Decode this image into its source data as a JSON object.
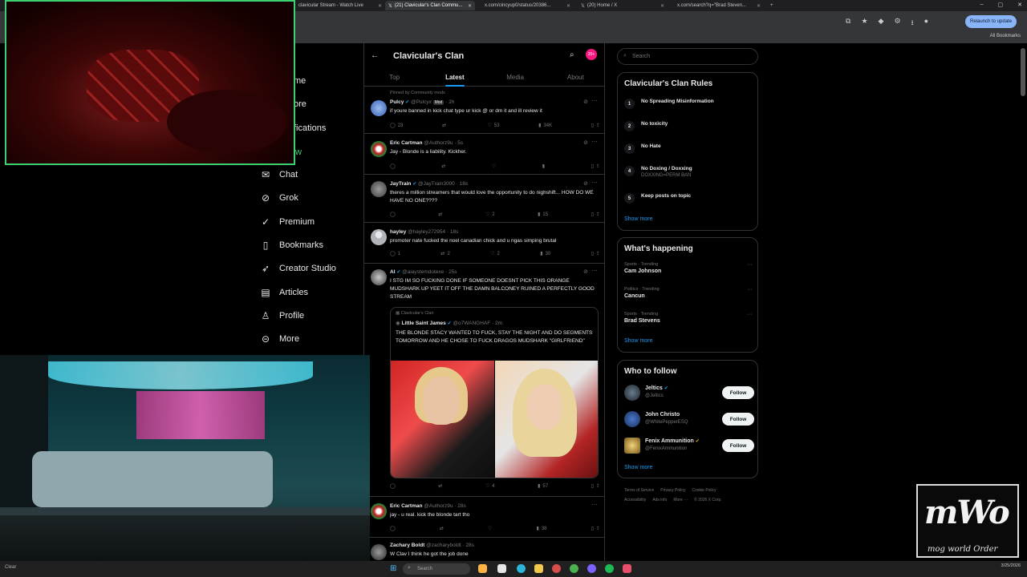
{
  "browser": {
    "tabs": [
      {
        "label": "clavicular Stream - Watch Live"
      },
      {
        "label": "(21) Clavicular's Clan Commu..."
      },
      {
        "label": "x.com/cincyup0/status/20386..."
      },
      {
        "label": "(20) Home / X"
      },
      {
        "label": "x.com/search?q=\"Brad Steven..."
      }
    ],
    "relaunch": "Relaunch to update",
    "all_bookmarks": "All Bookmarks"
  },
  "nav": {
    "partial_items": [
      "me",
      "ore",
      "fications",
      "w"
    ],
    "items": [
      {
        "label": "Chat",
        "icon": "mail-icon"
      },
      {
        "label": "Grok",
        "icon": "grok-icon"
      },
      {
        "label": "Premium",
        "icon": "premium-icon"
      },
      {
        "label": "Bookmarks",
        "icon": "bookmark-icon"
      },
      {
        "label": "Creator Studio",
        "icon": "rocket-icon"
      },
      {
        "label": "Articles",
        "icon": "article-icon"
      },
      {
        "label": "Profile",
        "icon": "person-icon"
      },
      {
        "label": "More",
        "icon": "more-circle-icon"
      }
    ]
  },
  "community": {
    "name": "Clavicular's Clan",
    "badge": "20+",
    "tabs": [
      "Top",
      "Latest",
      "Media",
      "About"
    ],
    "active_tab": "Latest"
  },
  "posts": [
    {
      "pinned": "Pinned by Community mods",
      "name": "Pulcy",
      "handle": "@Pulcyx",
      "badge": "Mod",
      "time": "· 2h",
      "text": "if youre banned in kick chat type ur kick @ or dm it and ill review it",
      "replies": "23",
      "reposts": "",
      "likes": "53",
      "views": "34K"
    },
    {
      "name": "Eric Cartman",
      "handle": "@Authorz9u",
      "time": "· 5s",
      "text": "Jay - Blonde is a liability. Kickher.",
      "replies": "",
      "reposts": "",
      "likes": "",
      "views": ""
    },
    {
      "name": "JayTrain",
      "handle": "@JayTrain3000",
      "time": "· 18s",
      "text": "theres a million streamers that would love the opportunity to do nighshift... HOW DO WE HAVE NO ONE????",
      "replies": "",
      "reposts": "",
      "likes": "2",
      "views": "15"
    },
    {
      "name": "hayley",
      "handle": "@hayley272954",
      "time": "· 18s",
      "text": "promoter nate fucked the noel canadian chick and u ngas simping brutal",
      "replies": "1",
      "reposts": "2",
      "likes": "2",
      "views": "30"
    },
    {
      "name": "Al",
      "handle": "@aiaystemdotexe",
      "time": "· 25s",
      "text": "I STG IM SO FUCKING DONE IF SOMEONE DOESNT PICK THIS ORANGE MUDSHARK UP YEET IT OFF THE DAMN BALCONEY RUINED A PERFECTLY GOOD STREAM",
      "quote": {
        "community": "Clavicular's Clan",
        "name": "Little Saint James",
        "handle": "@o7WANGHAF",
        "time": "· 2m",
        "text": "THE BLONDE STACY WANTED TO FUCK, STAY THE NIGHT AND DO SEGMENTS TOMORROW AND HE CHOSE TO FUCK DRAGOS MUDSHARK \"GIRLFRIEND\""
      },
      "replies": "",
      "reposts": "",
      "likes": "4",
      "views": "57"
    },
    {
      "name": "Eric Cartman",
      "handle": "@Authorz9u",
      "time": "· 28s",
      "text": "jay - u real. kick the blonde tart tho",
      "replies": "",
      "reposts": "",
      "likes": "",
      "views": "38"
    },
    {
      "name": "Zachary Boldt",
      "handle": "@zacharyboldt",
      "time": "· 28s",
      "text": "W Clav I think he got the job done"
    }
  ],
  "sidebar": {
    "search_placeholder": "Search",
    "rules_title": "Clavicular's Clan Rules",
    "rules": [
      {
        "num": "1",
        "text": "No Spreading Misinformation",
        "sub": ""
      },
      {
        "num": "2",
        "text": "No toxicity",
        "sub": ""
      },
      {
        "num": "3",
        "text": "No Hate",
        "sub": ""
      },
      {
        "num": "4",
        "text": "No Doxing / Doxxing",
        "sub": "DOXXING=PERM BAN"
      },
      {
        "num": "5",
        "text": "Keep posts on topic",
        "sub": ""
      }
    ],
    "show_more": "Show more",
    "happening_title": "What's happening",
    "trends": [
      {
        "category": "Sports · Trending",
        "name": "Cam Johnson"
      },
      {
        "category": "Politics · Trending",
        "name": "Cancun"
      },
      {
        "category": "Sports · Trending",
        "name": "Brad Stevens"
      }
    ],
    "follow_title": "Who to follow",
    "follow": [
      {
        "name": "Jeltics",
        "handle": "@Jeltics",
        "button": "Follow",
        "badge": "blue"
      },
      {
        "name": "John Christo",
        "handle": "@WhitePepperESQ",
        "button": "Follow",
        "badge": ""
      },
      {
        "name": "Fenix Ammunition",
        "handle": "@FenixAmmunition",
        "button": "Follow",
        "badge": "gold"
      }
    ],
    "footer": [
      "Terms of Service",
      "Privacy Policy",
      "Cookie Policy",
      "Accessibility",
      "Ads info",
      "More ···",
      "© 2026 X Corp."
    ]
  },
  "overlay": {
    "logo_big": "mWo",
    "logo_small": "mog world Order"
  },
  "taskbar": {
    "left_text": "Clear",
    "search_placeholder": "Search",
    "time": "",
    "date": "3/25/2026"
  },
  "colors": {
    "accent": "#1d9bf0",
    "background": "#000000",
    "border": "#2f3336",
    "muted": "#71767b",
    "cam_border": "#3bd16f"
  }
}
